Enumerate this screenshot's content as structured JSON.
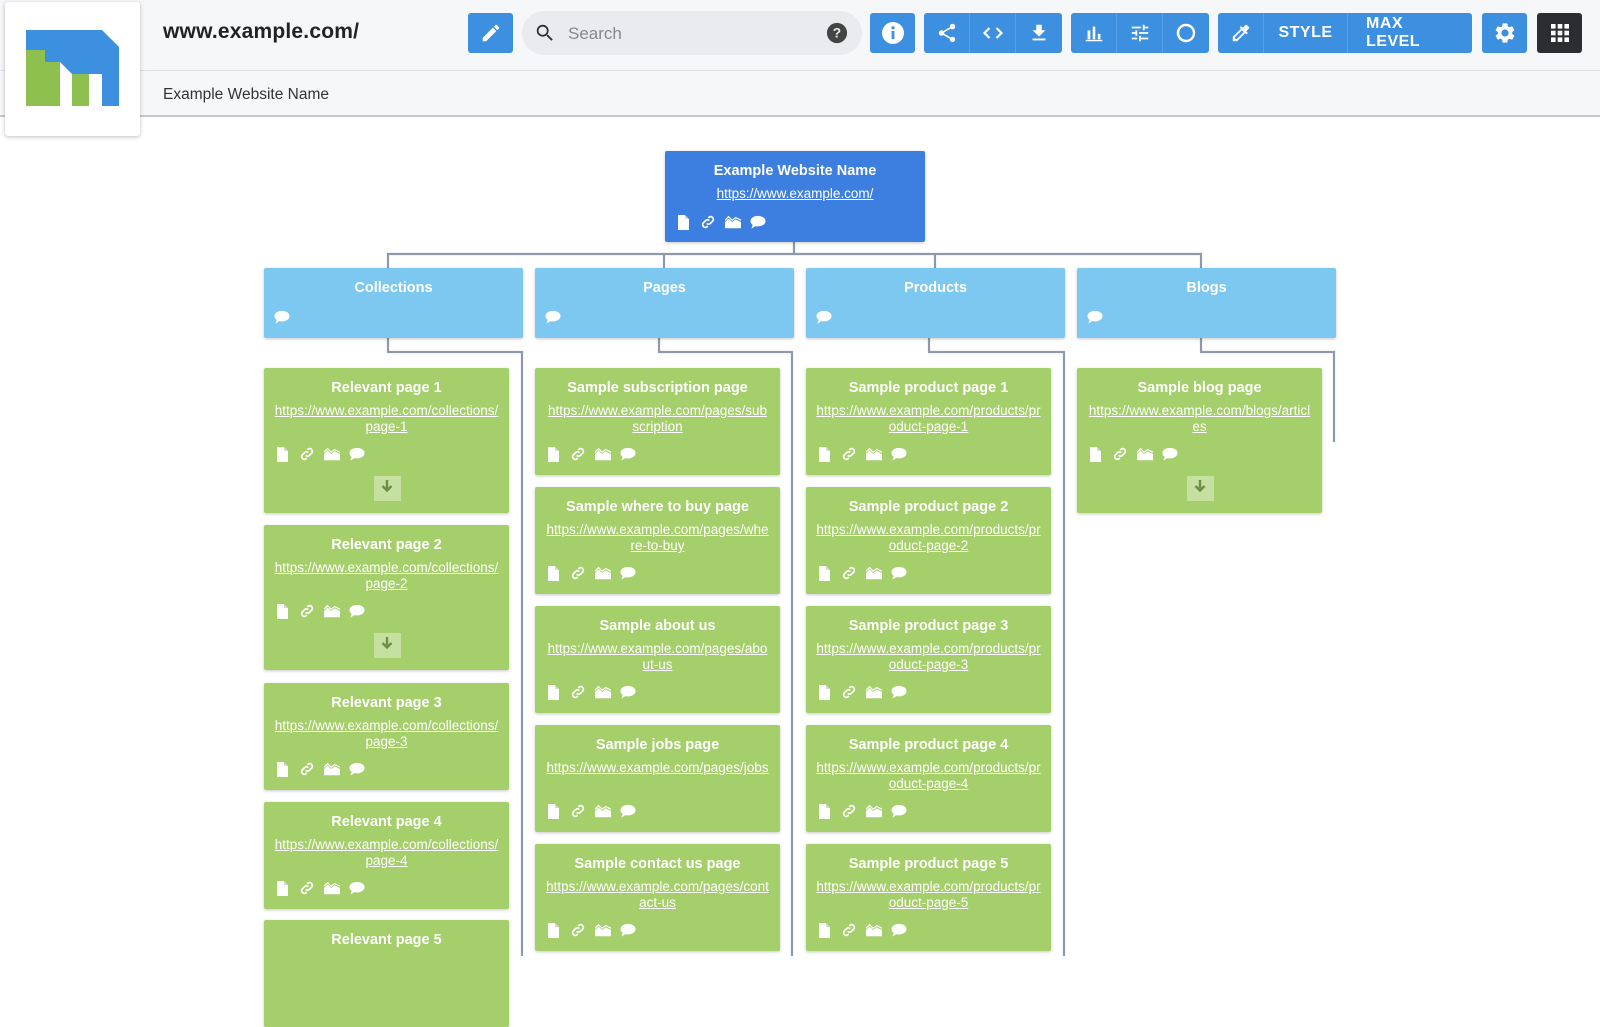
{
  "header": {
    "site_url": "www.example.com/",
    "site_name": "Example Website Name",
    "search_placeholder": "Search",
    "style_label": "STYLE",
    "max_level_label": "MAX LEVEL"
  },
  "colors": {
    "toolbar_blue": "#3d8fe0",
    "root_node": "#3d7fe0",
    "category_node": "#7dc8f0",
    "page_node": "#a5cf6a",
    "connector": "#8e9aab"
  },
  "tree": {
    "root": {
      "title": "Example Website Name",
      "url": "https://www.example.com/"
    },
    "categories": [
      {
        "title": "Collections",
        "pages": [
          {
            "title": "Relevant page 1",
            "url": "https://www.example.com/collections/page-1",
            "expand": true
          },
          {
            "title": "Relevant page 2",
            "url": "https://www.example.com/collections/page-2",
            "expand": true
          },
          {
            "title": "Relevant page 3",
            "url": "https://www.example.com/collections/page-3",
            "expand": false
          },
          {
            "title": "Relevant page 4",
            "url": "https://www.example.com/collections/page-4",
            "expand": false
          },
          {
            "title": "Relevant page 5",
            "url": "",
            "expand": false
          }
        ]
      },
      {
        "title": "Pages",
        "pages": [
          {
            "title": "Sample subscription page",
            "url": "https://www.example.com/pages/subscription",
            "expand": false
          },
          {
            "title": "Sample where to buy page",
            "url": "https://www.example.com/pages/where-to-buy",
            "expand": false
          },
          {
            "title": "Sample about us",
            "url": "https://www.example.com/pages/about-us",
            "expand": false
          },
          {
            "title": "Sample jobs page",
            "url": "https://www.example.com/pages/jobs",
            "expand": false
          },
          {
            "title": "Sample contact us page",
            "url": "https://www.example.com/pages/contact-us",
            "expand": false
          }
        ]
      },
      {
        "title": "Products",
        "pages": [
          {
            "title": "Sample product page 1",
            "url": "https://www.example.com/products/product-page-1",
            "expand": false
          },
          {
            "title": "Sample product page 2",
            "url": "https://www.example.com/products/product-page-2",
            "expand": false
          },
          {
            "title": "Sample product page 3",
            "url": "https://www.example.com/products/product-page-3",
            "expand": false
          },
          {
            "title": "Sample product page 4",
            "url": "https://www.example.com/products/product-page-4",
            "expand": false
          },
          {
            "title": "Sample product page 5",
            "url": "https://www.example.com/products/product-page-5",
            "expand": false
          }
        ]
      },
      {
        "title": "Blogs",
        "pages": [
          {
            "title": "Sample blog page",
            "url": "https://www.example.com/blogs/articles",
            "expand": true
          }
        ]
      }
    ]
  }
}
